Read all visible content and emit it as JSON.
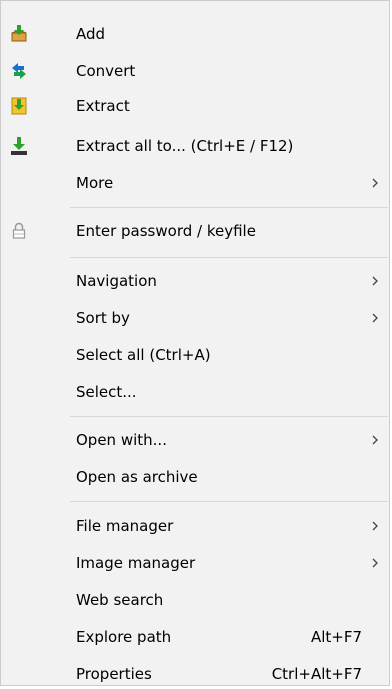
{
  "menu": {
    "items": [
      {
        "label": "Add",
        "icon": "add-archive-icon",
        "shortcut": "",
        "submenu": false
      },
      {
        "label": "Convert",
        "icon": "convert-icon",
        "shortcut": "",
        "submenu": false
      },
      {
        "label": "Extract",
        "icon": "extract-icon",
        "shortcut": "",
        "submenu": false
      },
      {
        "label": "Extract all to... (Ctrl+E / F12)",
        "icon": "extract-all-icon",
        "shortcut": "",
        "submenu": false
      },
      {
        "label": "More",
        "icon": "",
        "shortcut": "",
        "submenu": true
      },
      {
        "label": "Enter password / keyfile",
        "icon": "lock-icon",
        "shortcut": "",
        "submenu": false
      },
      {
        "label": "Navigation",
        "icon": "",
        "shortcut": "",
        "submenu": true
      },
      {
        "label": "Sort by",
        "icon": "",
        "shortcut": "",
        "submenu": true
      },
      {
        "label": "Select all (Ctrl+A)",
        "icon": "",
        "shortcut": "",
        "submenu": false
      },
      {
        "label": "Select...",
        "icon": "",
        "shortcut": "",
        "submenu": false
      },
      {
        "label": "Open with...",
        "icon": "",
        "shortcut": "",
        "submenu": true
      },
      {
        "label": "Open as archive",
        "icon": "",
        "shortcut": "",
        "submenu": false
      },
      {
        "label": "File manager",
        "icon": "",
        "shortcut": "",
        "submenu": true
      },
      {
        "label": "Image manager",
        "icon": "",
        "shortcut": "",
        "submenu": true
      },
      {
        "label": "Web search",
        "icon": "",
        "shortcut": "",
        "submenu": false
      },
      {
        "label": "Explore path",
        "icon": "",
        "shortcut": "Alt+F7",
        "submenu": false
      },
      {
        "label": "Properties",
        "icon": "",
        "shortcut": "Ctrl+Alt+F7",
        "submenu": false
      }
    ]
  },
  "colors": {
    "background": "#f2f2f2",
    "border": "#cccccc",
    "separator": "#d7d7d7",
    "text": "#000000",
    "arrow": "#444444"
  }
}
